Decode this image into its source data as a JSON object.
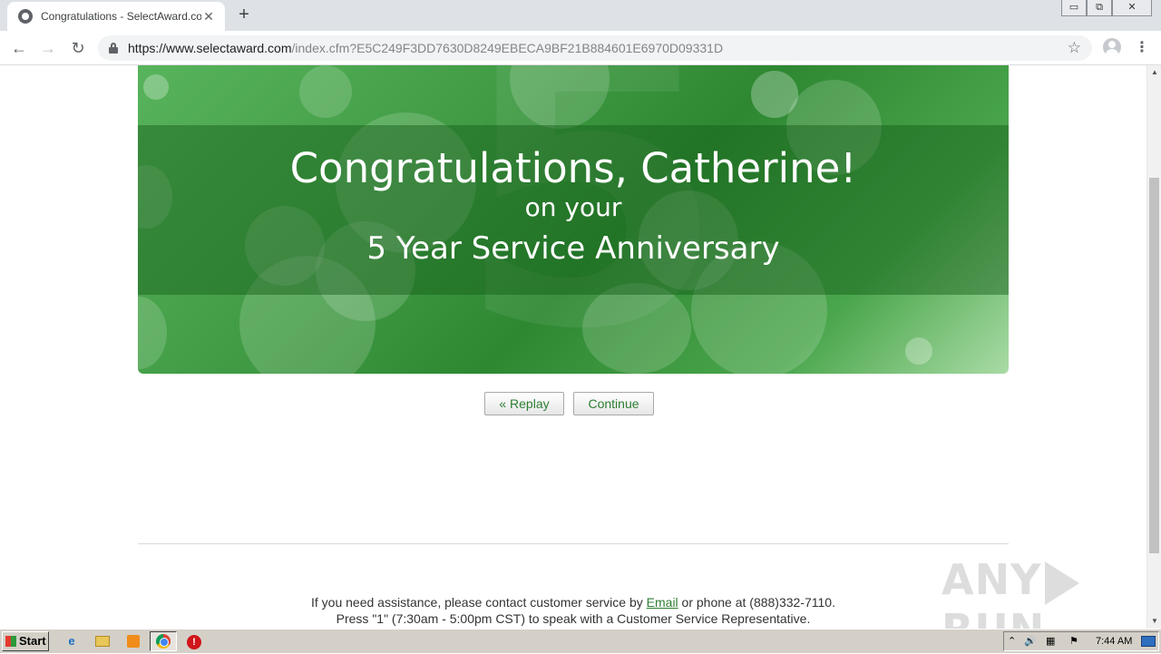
{
  "browser": {
    "tab_title": "Congratulations - SelectAward.com",
    "tab_close": "✕",
    "new_tab": "+",
    "url_host": "https://www.selectaward.com",
    "url_path": "/index.cfm?E5C249F3DD7630D8249EBECA9BF21B884601E6970D09331D",
    "nav": {
      "back": "←",
      "forward": "→",
      "reload": "↻"
    },
    "star": "☆",
    "menu": "⋮",
    "window_controls": {
      "minimize": "▭",
      "restore": "⧉",
      "close": "✕"
    }
  },
  "banner": {
    "headline": "Congratulations, Catherine!",
    "subline": "on your",
    "occasion": "5 Year Service Anniversary",
    "background_digit": "5"
  },
  "buttons": {
    "replay": "« Replay",
    "continue": "Continue"
  },
  "footer": {
    "line1_before": "If you need assistance, please contact customer service by ",
    "line1_link": "Email",
    "line1_after": " or phone at (888)332-7110.",
    "line2": "Press \"1\" (7:30am - 5:00pm CST) to speak with a Customer Service Representative."
  },
  "watermark": {
    "left": "ANY",
    "right": "RUN"
  },
  "taskbar": {
    "start_label": "Start",
    "ie_glyph": "e",
    "stop_glyph": "!",
    "tray_icons": {
      "chevron": "⌃",
      "speaker": "🔊",
      "network": "▦",
      "flag": "⚑"
    },
    "clock": "7:44 AM"
  },
  "colors": {
    "banner_green": "#2e8832",
    "link_green": "#2d7d32",
    "taskbar": "#d4d0c8"
  }
}
